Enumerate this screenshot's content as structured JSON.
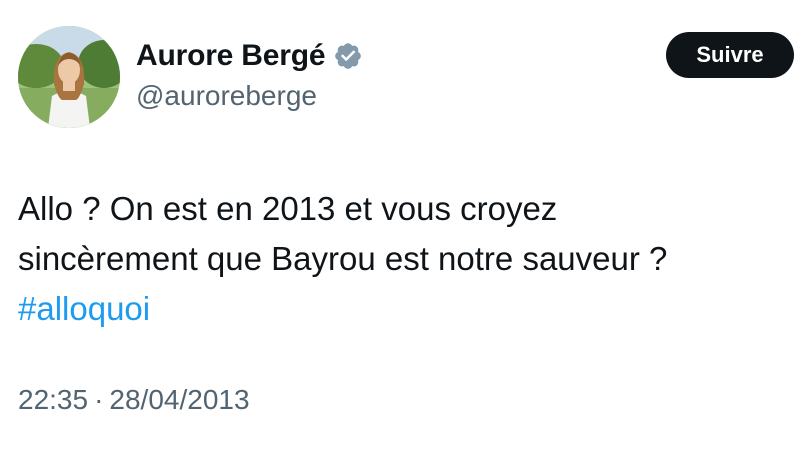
{
  "author": {
    "display_name": "Aurore Bergé",
    "handle": "@auroreberge",
    "verified": true,
    "badge_color": "#829aab"
  },
  "follow_button": {
    "label": "Suivre"
  },
  "tweet": {
    "lines": [
      "Allo ? On est en 2013 et vous croyez",
      "sincèrement que Bayrou est notre sauveur ?"
    ],
    "hashtag": "#alloquoi"
  },
  "meta": {
    "time": "22:35",
    "separator": "·",
    "date": "28/04/2013"
  },
  "colors": {
    "text": "#0f1419",
    "secondary": "#536471",
    "link": "#1d9bf0",
    "button_bg": "#0f1419"
  }
}
